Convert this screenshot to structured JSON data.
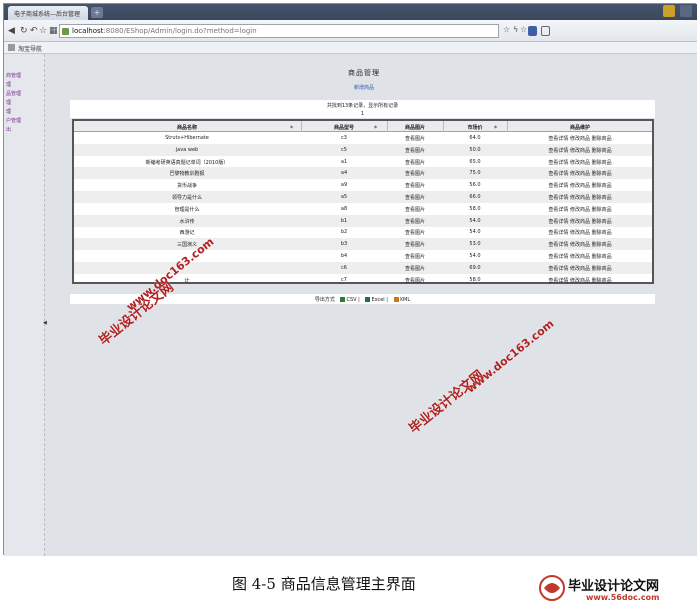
{
  "browser": {
    "tab_title": "电子商城系统—后台管理",
    "url_host": "localhost",
    "url_rest": ":8080/EShop/Admin/login.do?method=login",
    "bookmark": "淘宝导航"
  },
  "sidebar": {
    "items": [
      "商管理",
      "理",
      "品管理",
      "理",
      "理",
      "户管理",
      "出"
    ]
  },
  "page": {
    "title": "商品管理",
    "add_link": "新增商品",
    "summary": "共找到13条记录，显示所有记录",
    "page_number": "1"
  },
  "grid": {
    "headers": [
      "商品名称",
      "商品型号",
      "商品图片",
      "市场价",
      "商品维护"
    ],
    "rows": [
      {
        "name": "Struts+Hibernate",
        "model": "c3",
        "image": "查看图片",
        "price": "64.0",
        "actions": [
          "查看详情",
          "修改商品",
          "删除商品"
        ]
      },
      {
        "name": "java web",
        "model": "c5",
        "image": "查看图片",
        "price": "50.0",
        "actions": [
          "查看详情",
          "修改商品",
          "删除商品"
        ]
      },
      {
        "name": "新编考研英语真题记单词（2010版）",
        "model": "a1",
        "image": "查看图片",
        "price": "65.0",
        "actions": [
          "查看详情",
          "修改商品",
          "删除商品"
        ]
      },
      {
        "name": "巴黎物教训剧报",
        "model": "a4",
        "image": "查看图片",
        "price": "75.0",
        "actions": [
          "查看详情",
          "修改商品",
          "删除商品"
        ]
      },
      {
        "name": "货币战争",
        "model": "a9",
        "image": "查看图片",
        "price": "56.0",
        "actions": [
          "查看详情",
          "修改商品",
          "删除商品"
        ]
      },
      {
        "name": "领导力是什么",
        "model": "a5",
        "image": "查看图片",
        "price": "66.0",
        "actions": [
          "查看详情",
          "修改商品",
          "删除商品"
        ]
      },
      {
        "name": "管理是什么",
        "model": "a8",
        "image": "查看图片",
        "price": "58.0",
        "actions": [
          "查看详情",
          "修改商品",
          "删除商品"
        ]
      },
      {
        "name": "水浒传",
        "model": "b1",
        "image": "查看图片",
        "price": "54.0",
        "actions": [
          "查看详情",
          "修改商品",
          "删除商品"
        ]
      },
      {
        "name": "西游记",
        "model": "b2",
        "image": "查看图片",
        "price": "54.0",
        "actions": [
          "查看详情",
          "修改商品",
          "删除商品"
        ]
      },
      {
        "name": "三国演义",
        "model": "b3",
        "image": "查看图片",
        "price": "53.0",
        "actions": [
          "查看详情",
          "修改商品",
          "删除商品"
        ]
      },
      {
        "name": "",
        "model": "b4",
        "image": "查看图片",
        "price": "54.0",
        "actions": [
          "查看详情",
          "修改商品",
          "删除商品"
        ]
      },
      {
        "name": "",
        "model": "c6",
        "image": "查看图片",
        "price": "69.0",
        "actions": [
          "查看详情",
          "修改商品",
          "删除商品"
        ]
      },
      {
        "name": "计",
        "model": "c7",
        "image": "查看图片",
        "price": "58.0",
        "actions": [
          "查看详情",
          "修改商品",
          "删除商品"
        ]
      }
    ]
  },
  "export": {
    "label": "导出方式",
    "csv": "CSV",
    "excel": "Excel",
    "xml": "XML"
  },
  "watermarks": {
    "site_name": "毕业设计论文网",
    "site_url": "www.doc163.com"
  },
  "caption": "图 4-5 商品信息管理主界面",
  "logo": {
    "name": "毕业设计论文网",
    "url": "www.56doc.com"
  },
  "colors": {
    "watermark": "#b0201f",
    "link": "#2b55b8",
    "menu": "#7a2b8a"
  }
}
